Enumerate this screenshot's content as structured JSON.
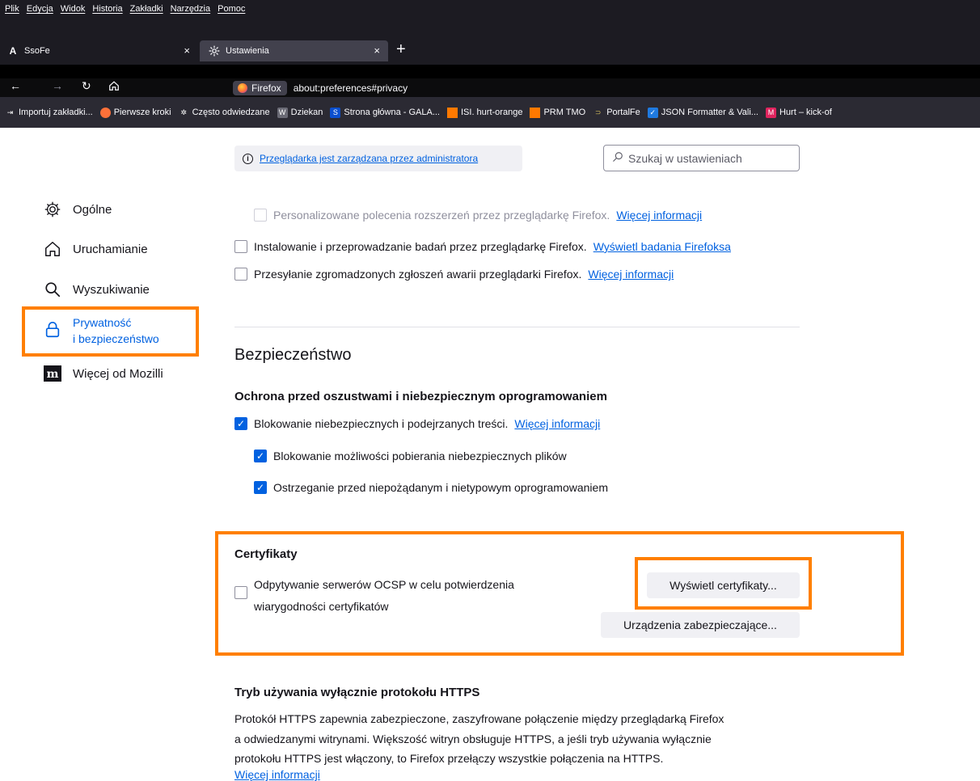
{
  "menubar": {
    "items": [
      "Plik",
      "Edycja",
      "Widok",
      "Historia",
      "Zakładki",
      "Narzędzia",
      "Pomoc"
    ]
  },
  "tabs": [
    {
      "icon": "A",
      "title": "SsoFe",
      "close": "×"
    },
    {
      "icon": "gear-icon",
      "title": "Ustawienia",
      "close": "×"
    }
  ],
  "new_tab": "+",
  "navbar": {
    "identity": "Firefox",
    "url": "about:preferences#privacy"
  },
  "bookmarks": [
    {
      "label": "Importuj zakładki...",
      "icon": "import-icon",
      "color": "#2b2a33"
    },
    {
      "label": "Pierwsze kroki",
      "icon": "firefox-icon",
      "color": "#ff7139"
    },
    {
      "label": "Często odwiedzane",
      "icon": "gear-icon",
      "color": "#2b2a33"
    },
    {
      "label": "Dziekan",
      "icon": "dziekan-icon",
      "color": "#6a6a75"
    },
    {
      "label": "Strona główna - GALA...",
      "icon": "gala-icon",
      "color": "#0b4fcf"
    },
    {
      "label": "ISI. hurt-orange",
      "icon": "orange-icon",
      "color": "#ff7900"
    },
    {
      "label": "PRM TMO",
      "icon": "orange-icon",
      "color": "#ff7900"
    },
    {
      "label": "PortalFe",
      "icon": "portal-icon",
      "color": "#9b8c3a"
    },
    {
      "label": "JSON Formatter & Vali...",
      "icon": "check-icon",
      "color": "#1f7ae0"
    },
    {
      "label": "Hurt – kick-of",
      "icon": "hurt-icon",
      "color": "#e0245e"
    }
  ],
  "banner": {
    "info": "i",
    "text": "Przeglądarka jest zarządzana przez administratora"
  },
  "search": {
    "placeholder": "Szukaj w ustawieniach",
    "value": ""
  },
  "sidebar": {
    "items": [
      {
        "label": "Ogólne",
        "icon": "gear-icon"
      },
      {
        "label": "Uruchamianie",
        "icon": "home-icon"
      },
      {
        "label": "Wyszukiwanie",
        "icon": "search-icon"
      },
      {
        "label_line1": "Prywatność",
        "label_line2": "i bezpieczeństwo",
        "icon": "lock-icon",
        "active": true
      },
      {
        "label": "Więcej od Mozilli",
        "icon": "mozilla-icon"
      }
    ]
  },
  "data_collection": {
    "personalized": {
      "label": "Personalizowane polecenia rozszerzeń przez przeglądarkę Firefox.",
      "link": "Więcej informacji",
      "checked": false,
      "disabled": true
    },
    "studies": {
      "label": "Instalowanie i przeprowadzanie badań przez przeglądarkę Firefox.",
      "link": "Wyświetl badania Firefoksa",
      "checked": false
    },
    "crash": {
      "label": "Przesyłanie zgromadzonych zgłoszeń awarii przeglądarki Firefox.",
      "link": "Więcej informacji",
      "checked": false
    }
  },
  "security": {
    "title": "Bezpieczeństwo",
    "deceptive": {
      "heading": "Ochrona przed oszustwami i niebezpiecznym oprogramowaniem",
      "block": {
        "label": "Blokowanie niebezpiecznych i podejrzanych treści.",
        "link": "Więcej informacji",
        "checked": true
      },
      "downloads": {
        "label": "Blokowanie możliwości pobierania niebezpiecznych plików",
        "checked": true
      },
      "unwanted": {
        "label": "Ostrzeganie przed niepożądanym i nietypowym oprogramowaniem",
        "checked": true
      }
    },
    "certificates": {
      "heading": "Certyfikaty",
      "ocsp_line1": "Odpytywanie serwerów OCSP w celu potwierdzenia",
      "ocsp_line2": "wiarygodności certyfikatów",
      "ocsp_checked": false,
      "view_button": "Wyświetl certyfikaty...",
      "devices_button": "Urządzenia zabezpieczające..."
    },
    "https": {
      "heading": "Tryb używania wyłącznie protokołu HTTPS",
      "line1": "Protokół HTTPS zapewnia zabezpieczone, zaszyfrowane połączenie między przeglądarką Firefox",
      "line2": "a odwiedzanymi witrynami. Większość witryn obsługuje HTTPS, a jeśli tryb używania wyłącznie",
      "line3": "protokołu HTTPS jest włączony, to Firefox przełączy wszystkie połączenia na HTTPS.",
      "link": "Więcej informacji"
    }
  },
  "colors": {
    "highlight": "#ff7f00",
    "accent": "#0061e0",
    "chrome_dark": "#1c1b22"
  }
}
